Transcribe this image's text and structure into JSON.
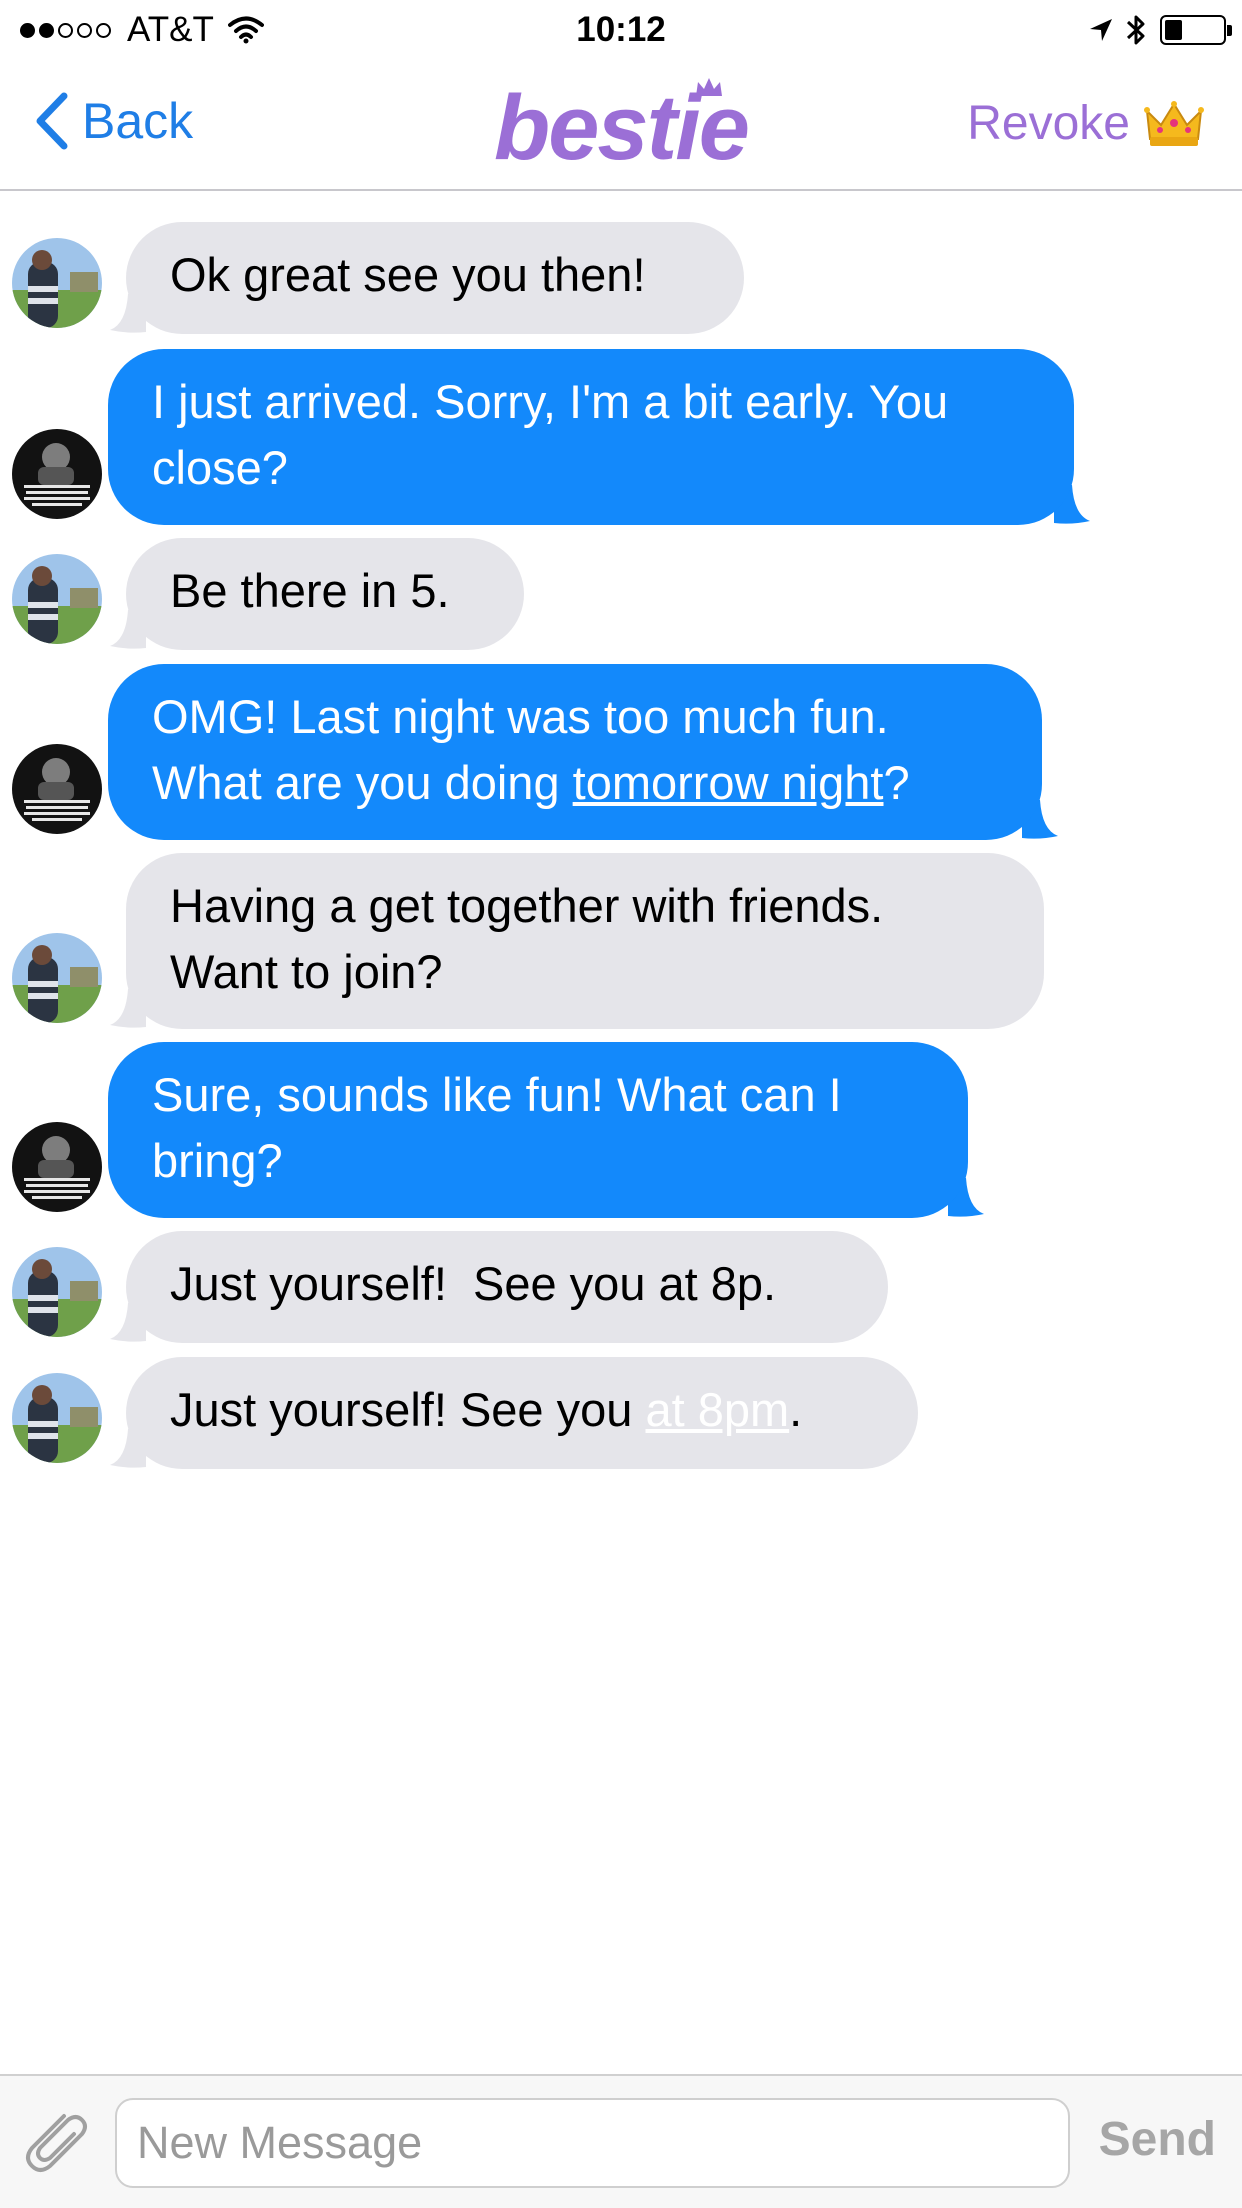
{
  "status_bar": {
    "carrier": "AT&T",
    "time": "10:12",
    "signal_bars": 2,
    "signal_total": 5,
    "battery_level": 0.3
  },
  "nav": {
    "back_label": "Back",
    "logo_text": "bestie",
    "revoke_label": "Revoke",
    "revoke_icon": "crown-icon"
  },
  "messages": [
    {
      "direction": "in",
      "text": "Ok great see you then!"
    },
    {
      "direction": "out",
      "text": "I just arrived. Sorry, I'm a bit early. You close?"
    },
    {
      "direction": "in",
      "text": "Be there in 5."
    },
    {
      "direction": "out",
      "text_before": "OMG! Last night was too much fun. What are you doing ",
      "link": "tomorrow night",
      "text_after": "?"
    },
    {
      "direction": "in",
      "text": "Having a get together with friends. Want to join?"
    },
    {
      "direction": "out",
      "text": "Sure, sounds like fun! What can I bring?"
    },
    {
      "direction": "in",
      "text": "Just yourself!  See you at 8p."
    },
    {
      "direction": "in",
      "text_before": "Just yourself! See you ",
      "link": "at 8pm",
      "text_after": "."
    }
  ],
  "input": {
    "placeholder": "New Message",
    "value": "",
    "send_label": "Send",
    "attach_icon": "paperclip-icon"
  },
  "colors": {
    "accent_blue": "#1f7ee6",
    "brand_purple": "#9b6fd6",
    "outgoing_bubble": "#1389fb",
    "incoming_bubble": "#e5e5ea"
  }
}
